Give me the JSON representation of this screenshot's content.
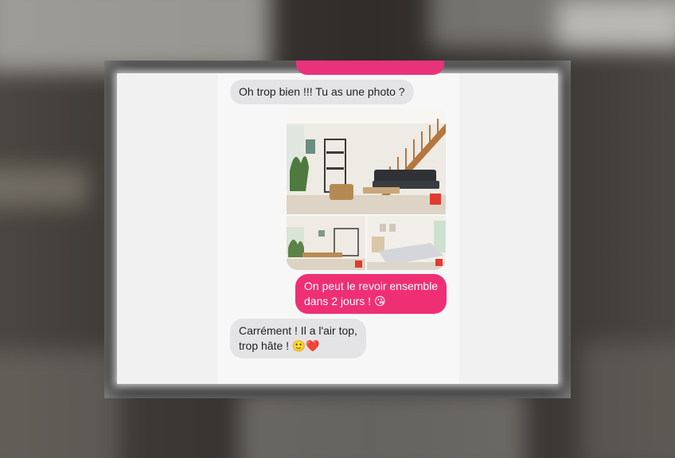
{
  "messages": [
    {
      "sender": "other",
      "text": "Oh trop bien !!! Tu as une photo ?"
    },
    {
      "sender": "me",
      "type": "photos",
      "count": 3
    },
    {
      "sender": "me",
      "line1": "On peut le revoir ensemble",
      "line2": "dans 2 jours ! 😘"
    },
    {
      "sender": "other",
      "line1": "Carrément ! Il a l'air top,",
      "line2": "trop hâte ! 🙂❤️"
    }
  ],
  "colors": {
    "outgoing": "#ef2f74",
    "incoming": "#e4e4e6",
    "badge": "#e23b2f"
  }
}
